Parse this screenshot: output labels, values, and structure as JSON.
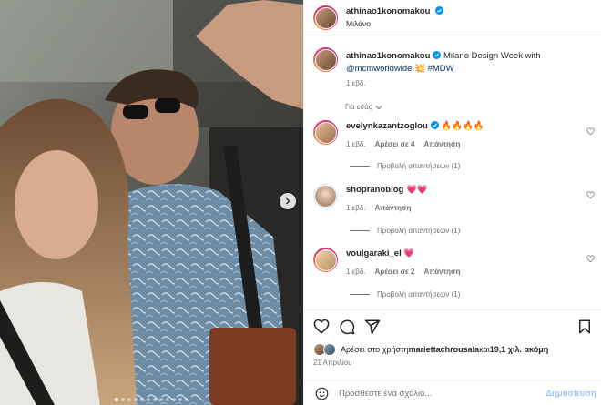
{
  "header": {
    "username": "athinao1konomakou",
    "location": "Μιλάνο"
  },
  "caption": {
    "username": "athinao1konomakou",
    "text_1": " Milano Design Week with",
    "mention": "@mcmworldwide",
    "emoji": "💥",
    "hashtag": "#MDW",
    "time": "1 εβδ."
  },
  "translate_label": "Για εσάς",
  "comments": [
    {
      "username": "evelynkazantzoglou",
      "text": "🔥🔥🔥🔥",
      "time": "1 εβδ.",
      "likes": "Αρέσει σε 4",
      "reply": "Απάντηση",
      "view_replies": "Προβολή απαντήσεων (1)"
    },
    {
      "username": "shopranoblog",
      "text": "💗💗",
      "time": "1 εβδ.",
      "likes": "",
      "reply": "Απάντηση",
      "view_replies": "Προβολή απαντήσεων (1)"
    },
    {
      "username": "voulgaraki_el",
      "text": "💗",
      "time": "1 εβδ.",
      "likes": "Αρέσει σε 2",
      "reply": "Απάντηση",
      "view_replies": "Προβολή απαντήσεων (1)"
    }
  ],
  "likes": {
    "prefix": "Αρέσει στο χρήστη ",
    "user": "mariettachrousala",
    "middle": " και ",
    "count": "19,1 χιλ. ακόμη"
  },
  "date": "21 Απριλίου",
  "add_comment": {
    "placeholder": "Προσθέστε ένα σχόλιο...",
    "post_label": "Δημοσίευση"
  },
  "carousel": {
    "count": 12,
    "active_index": 0
  },
  "colors": {
    "link": "#00376b",
    "verified": "#0095f6",
    "heart": "#ed4956",
    "post_button": "#9ac7f5"
  }
}
